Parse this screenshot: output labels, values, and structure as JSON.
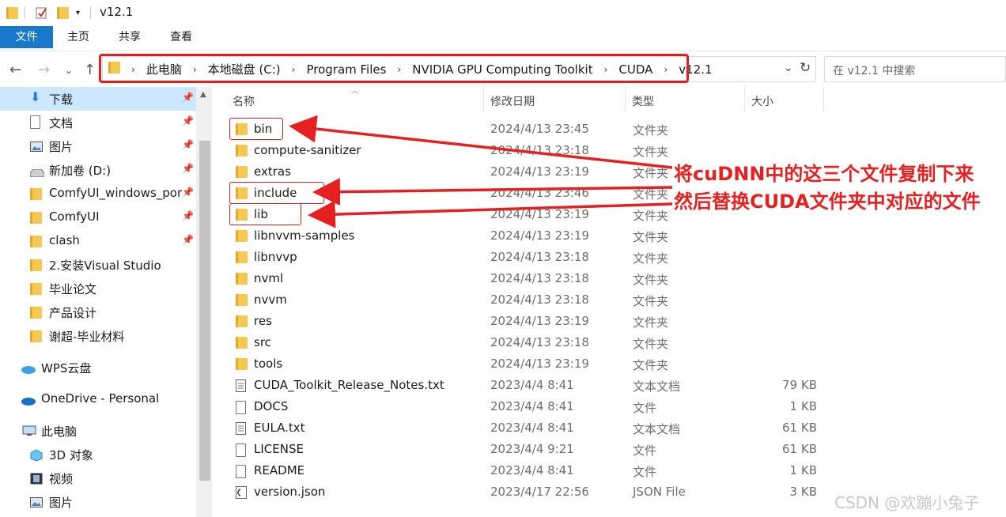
{
  "window": {
    "title": "v12.1"
  },
  "ribbon": {
    "tabs": [
      "文件",
      "主页",
      "共享",
      "查看"
    ]
  },
  "address": {
    "crumbs": [
      "此电脑",
      "本地磁盘 (C:)",
      "Program Files",
      "NVIDIA GPU Computing Toolkit",
      "CUDA",
      "v12.1"
    ]
  },
  "search": {
    "placeholder": "在 v12.1 中搜索"
  },
  "sidebar": {
    "items": [
      {
        "label": "下载",
        "icon": "download-icon",
        "pinned": true
      },
      {
        "label": "文档",
        "icon": "document-icon",
        "pinned": true
      },
      {
        "label": "图片",
        "icon": "picture-icon",
        "pinned": true
      },
      {
        "label": "新加卷 (D:)",
        "icon": "drive-icon",
        "pinned": true
      },
      {
        "label": "ComfyUI_windows_por",
        "icon": "folder-icon",
        "pinned": true
      },
      {
        "label": "ComfyUI",
        "icon": "folder-icon",
        "pinned": true
      },
      {
        "label": "clash",
        "icon": "folder-icon",
        "pinned": true
      },
      {
        "label": "2.安装Visual Studio",
        "icon": "folder-icon",
        "pinned": false
      },
      {
        "label": "毕业论文",
        "icon": "folder-icon",
        "pinned": false
      },
      {
        "label": "产品设计",
        "icon": "folder-icon",
        "pinned": false
      },
      {
        "label": "谢超-毕业材料",
        "icon": "folder-icon",
        "pinned": false
      },
      {
        "label": "WPS云盘",
        "icon": "cloud-icon",
        "pinned": false
      },
      {
        "label": "OneDrive - Personal",
        "icon": "cloud-icon",
        "pinned": false
      },
      {
        "label": "此电脑",
        "icon": "computer-icon",
        "pinned": false
      },
      {
        "label": "3D 对象",
        "icon": "cube-icon",
        "pinned": false
      },
      {
        "label": "视频",
        "icon": "video-icon",
        "pinned": false
      },
      {
        "label": "图片",
        "icon": "picture-icon",
        "pinned": false
      }
    ]
  },
  "columns": {
    "name": "名称",
    "date": "修改日期",
    "type": "类型",
    "size": "大小"
  },
  "files": [
    {
      "name": "bin",
      "date": "2024/4/13 23:45",
      "type": "文件夹",
      "size": "",
      "kind": "folder"
    },
    {
      "name": "compute-sanitizer",
      "date": "2024/4/13 23:18",
      "type": "文件夹",
      "size": "",
      "kind": "folder"
    },
    {
      "name": "extras",
      "date": "2024/4/13 23:19",
      "type": "文件夹",
      "size": "",
      "kind": "folder"
    },
    {
      "name": "include",
      "date": "2024/4/13 23:46",
      "type": "文件夹",
      "size": "",
      "kind": "folder"
    },
    {
      "name": "lib",
      "date": "2024/4/13 23:19",
      "type": "文件夹",
      "size": "",
      "kind": "folder"
    },
    {
      "name": "libnvvm-samples",
      "date": "2024/4/13 23:19",
      "type": "文件夹",
      "size": "",
      "kind": "folder"
    },
    {
      "name": "libnvvp",
      "date": "2024/4/13 23:18",
      "type": "文件夹",
      "size": "",
      "kind": "folder"
    },
    {
      "name": "nvml",
      "date": "2024/4/13 23:18",
      "type": "文件夹",
      "size": "",
      "kind": "folder"
    },
    {
      "name": "nvvm",
      "date": "2024/4/13 23:18",
      "type": "文件夹",
      "size": "",
      "kind": "folder"
    },
    {
      "name": "res",
      "date": "2024/4/13 23:19",
      "type": "文件夹",
      "size": "",
      "kind": "folder"
    },
    {
      "name": "src",
      "date": "2024/4/13 23:18",
      "type": "文件夹",
      "size": "",
      "kind": "folder"
    },
    {
      "name": "tools",
      "date": "2024/4/13 23:19",
      "type": "文件夹",
      "size": "",
      "kind": "folder"
    },
    {
      "name": "CUDA_Toolkit_Release_Notes.txt",
      "date": "2023/4/4 8:41",
      "type": "文本文档",
      "size": "79 KB",
      "kind": "txt"
    },
    {
      "name": "DOCS",
      "date": "2023/4/4 8:41",
      "type": "文件",
      "size": "1 KB",
      "kind": "file"
    },
    {
      "name": "EULA.txt",
      "date": "2023/4/4 8:41",
      "type": "文本文档",
      "size": "61 KB",
      "kind": "txt"
    },
    {
      "name": "LICENSE",
      "date": "2023/4/4 9:21",
      "type": "文件",
      "size": "61 KB",
      "kind": "file"
    },
    {
      "name": "README",
      "date": "2023/4/4 8:41",
      "type": "文件",
      "size": "1 KB",
      "kind": "file"
    },
    {
      "name": "version.json",
      "date": "2023/4/17 22:56",
      "type": "JSON File",
      "size": "3 KB",
      "kind": "json"
    }
  ],
  "annotation": {
    "line1": "将cuDNN中的这三个文件复制下来",
    "line2": "然后替换CUDA文件夹中对应的文件",
    "color": "#e62020"
  },
  "watermark": "CSDN @欢蹦小兔子"
}
